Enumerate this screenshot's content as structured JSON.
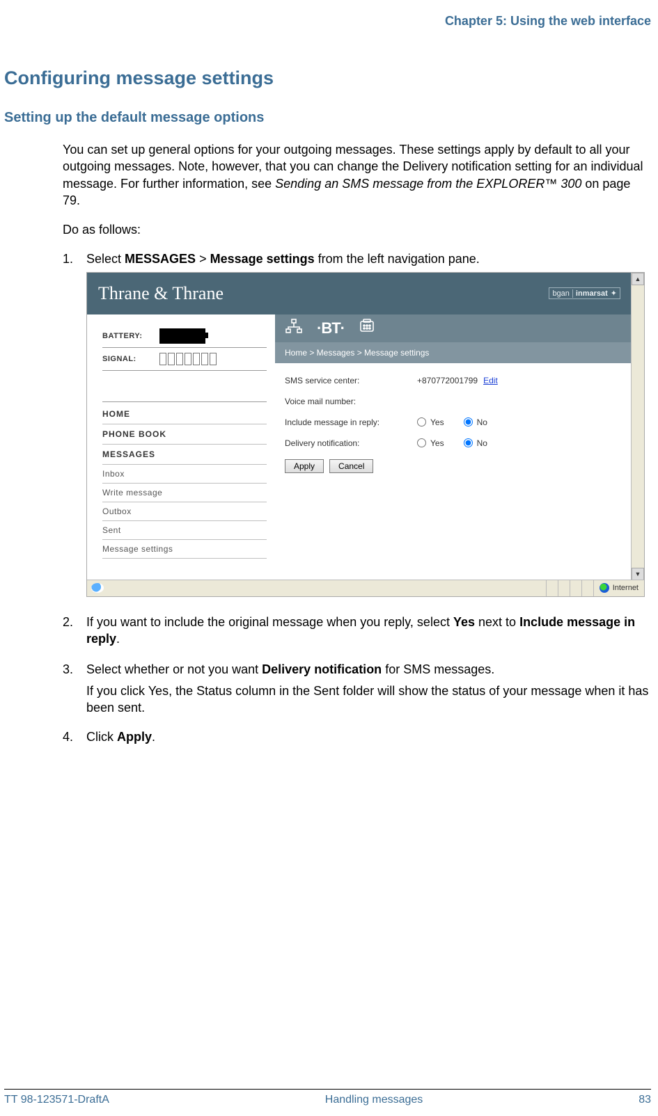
{
  "header": {
    "chapter": "Chapter 5: Using the web interface"
  },
  "titles": {
    "section": "Configuring message settings",
    "subsection": "Setting up the default message options"
  },
  "paras": {
    "intro_a": "You can set up general options for your outgoing messages. These settings apply by default to all your outgoing messages. Note, however, that you can change the Delivery notification setting for an individual message. For further information, see ",
    "intro_ref": "Sending an SMS message from the EXPLORER™ 300",
    "intro_b": " on page 79.",
    "do_as": "Do as follows:"
  },
  "steps": {
    "s1_pre": "Select ",
    "s1_b1": "MESSAGES",
    "s1_mid": " > ",
    "s1_b2": "Message settings",
    "s1_post": " from the left navigation pane.",
    "s2_pre": "If you want to include the original message when you reply, select ",
    "s2_b1": "Yes",
    "s2_mid": " next to ",
    "s2_b2": "Include message in reply",
    "s2_post": ".",
    "s3_pre": "Select whether or not you want ",
    "s3_b1": "Delivery notification",
    "s3_post": " for SMS messages.",
    "s3_sub": "If you click Yes, the Status column in the Sent folder will show the status of your message when it has been sent.",
    "s4_pre": "Click ",
    "s4_b1": "Apply",
    "s4_post": "."
  },
  "shot": {
    "brand": "Thrane & Thrane",
    "bgan": "bgan",
    "inmarsat": "inmarsat",
    "battery_label": "BATTERY:",
    "signal_label": "SIGNAL:",
    "nav": {
      "home": "HOME",
      "phonebook": "PHONE BOOK",
      "messages": "MESSAGES",
      "inbox": "Inbox",
      "write": "Write message",
      "outbox": "Outbox",
      "sent": "Sent",
      "settings": "Message settings"
    },
    "iconbar": {
      "bt": "BT"
    },
    "breadcrumb": "Home > Messages > Message settings",
    "settings": {
      "sms_center_lbl": "SMS service center:",
      "sms_center_val": "+870772001799",
      "edit": "Edit",
      "voicemail_lbl": "Voice mail number:",
      "include_lbl": "Include message in reply:",
      "delivery_lbl": "Delivery notification:",
      "yes": "Yes",
      "no": "No",
      "apply": "Apply",
      "cancel": "Cancel"
    },
    "status": {
      "internet": "Internet"
    }
  },
  "footer": {
    "left": "TT 98-123571-DraftA",
    "center": "Handling messages",
    "right": "83"
  }
}
